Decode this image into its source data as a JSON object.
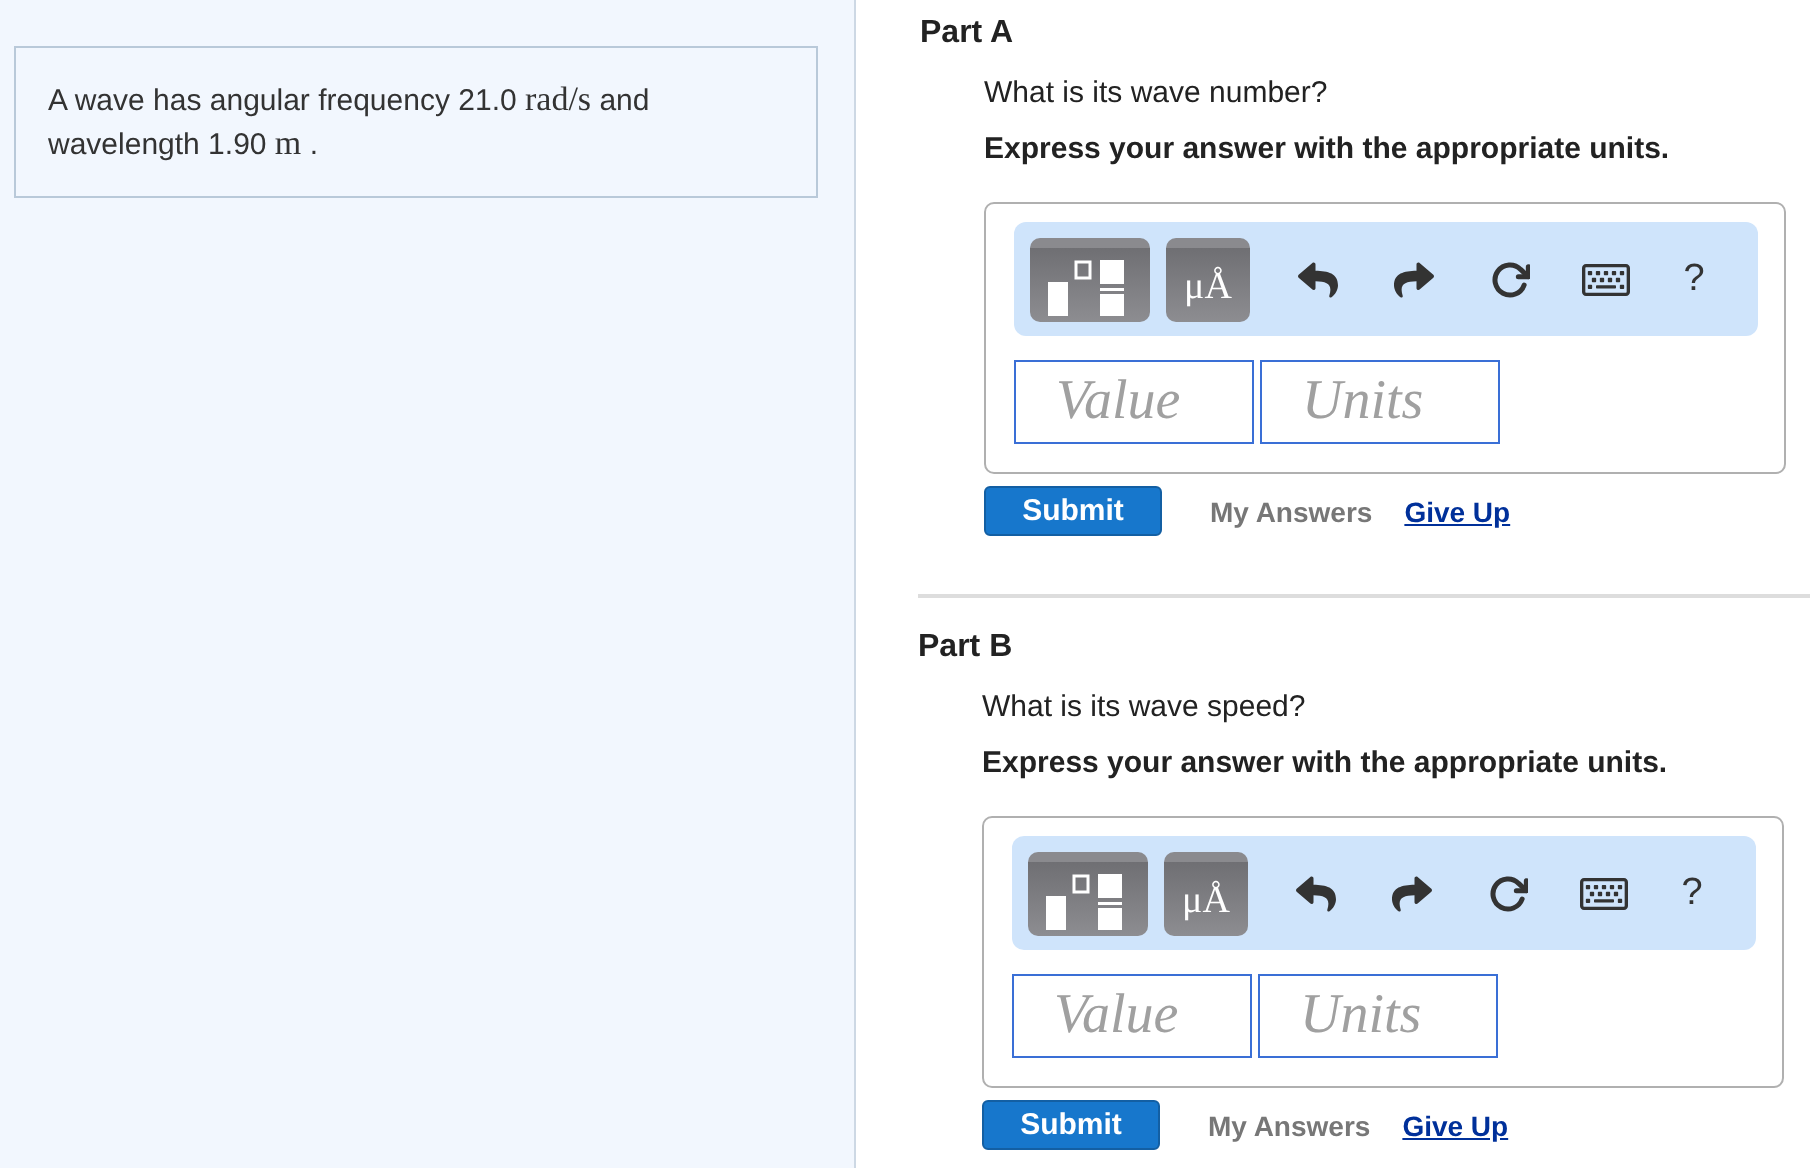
{
  "problem": {
    "segments": [
      {
        "text": "A wave has angular frequency 21.0 ",
        "math": false
      },
      {
        "text": "rad/s",
        "math": true
      },
      {
        "text": " and wavelength 1.90 ",
        "math": false
      },
      {
        "text": "m",
        "math": true
      },
      {
        "text": " .",
        "math": false
      }
    ]
  },
  "parts": [
    {
      "title": "Part A",
      "question": "What is its wave number?",
      "instruction": "Express your answer with the appropriate units.",
      "toolbar": {
        "units_label": "μÅ",
        "help": "?"
      },
      "value_placeholder": "Value",
      "units_placeholder": "Units",
      "submit": "Submit",
      "my_answers": "My Answers",
      "give_up": "Give Up"
    },
    {
      "title": "Part B",
      "question": "What is its wave speed?",
      "instruction": "Express your answer with the appropriate units.",
      "toolbar": {
        "units_label": "μÅ",
        "help": "?"
      },
      "value_placeholder": "Value",
      "units_placeholder": "Units",
      "submit": "Submit",
      "my_answers": "My Answers",
      "give_up": "Give Up"
    }
  ]
}
